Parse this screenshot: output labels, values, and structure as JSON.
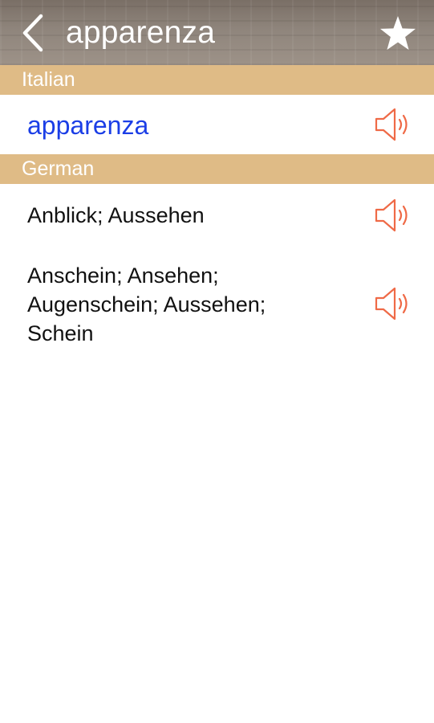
{
  "header": {
    "title": "apparenza",
    "back_icon": "chevron-left-icon",
    "favorite_icon": "star-icon"
  },
  "sections": [
    {
      "label": "Italian",
      "entries": [
        {
          "text": "apparenza",
          "audio_icon": "speaker-icon"
        }
      ]
    },
    {
      "label": "German",
      "entries": [
        {
          "text": "Anblick; Aussehen",
          "audio_icon": "speaker-icon"
        },
        {
          "text": "Anschein; Ansehen; Augenschein; Aussehen; Schein",
          "audio_icon": "speaker-icon"
        }
      ]
    }
  ],
  "colors": {
    "section_header_bg": "#dfbb86",
    "italian_word": "#1b3ee6",
    "speaker_icon": "#ef6a47",
    "text": "#111111"
  }
}
